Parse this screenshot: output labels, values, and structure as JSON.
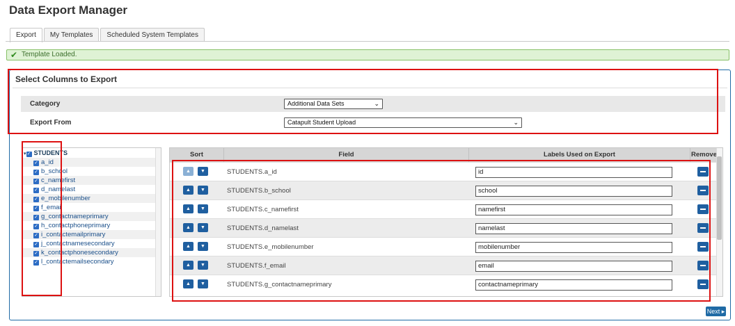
{
  "title": "Data Export Manager",
  "tabs": [
    "Export",
    "My Templates",
    "Scheduled System Templates"
  ],
  "alert": "Template Loaded.",
  "panel_title": "Select Columns to Export",
  "category": {
    "label": "Category",
    "value": "Additional Data Sets"
  },
  "export_from": {
    "label": "Export From",
    "value": "Catapult Student Upload"
  },
  "tree": {
    "root": "STUDENTS",
    "items": [
      "a_id",
      "b_school",
      "c_namefirst",
      "d_namelast",
      "e_mobilenumber",
      "f_email",
      "g_contactnameprimary",
      "h_contactphoneprimary",
      "i_contactemailprimary",
      "j_contactnamesecondary",
      "k_contactphonesecondary",
      "l_contactemailsecondary"
    ]
  },
  "grid": {
    "headers": {
      "sort": "Sort",
      "field": "Field",
      "label": "Labels Used on Export",
      "remove": "Remove"
    },
    "rows": [
      {
        "field": "STUDENTS.a_id",
        "label": "id"
      },
      {
        "field": "STUDENTS.b_school",
        "label": "school"
      },
      {
        "field": "STUDENTS.c_namefirst",
        "label": "namefirst"
      },
      {
        "field": "STUDENTS.d_namelast",
        "label": "namelast"
      },
      {
        "field": "STUDENTS.e_mobilenumber",
        "label": "mobilenumber"
      },
      {
        "field": "STUDENTS.f_email",
        "label": "email"
      },
      {
        "field": "STUDENTS.g_contactnameprimary",
        "label": "contactnameprimary"
      }
    ]
  },
  "next_label": "Next",
  "icons": {
    "check": "check-icon",
    "up": "arrow-up-icon",
    "down": "arrow-down-icon",
    "remove": "minus-icon"
  },
  "colors": {
    "accent": "#1f5fa0",
    "alert_bg": "#dff2d5",
    "highlight": "#dd1111"
  }
}
